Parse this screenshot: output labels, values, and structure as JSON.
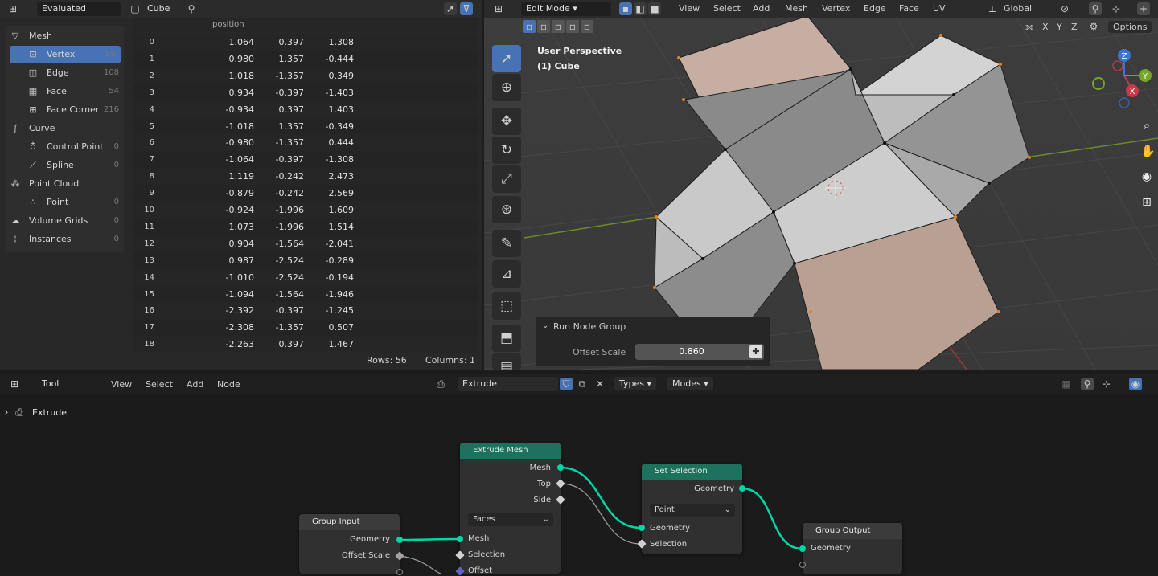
{
  "spreadsheet": {
    "header": {
      "mode": "Evaluated",
      "object": "Cube"
    },
    "column": "position",
    "tree": [
      {
        "label": "Mesh",
        "count": "",
        "level": 0,
        "icon": "mesh-icon",
        "glyph": "▽"
      },
      {
        "label": "Vertex",
        "count": "56",
        "level": 1,
        "icon": "vertex-icon",
        "glyph": "⊡",
        "selected": true
      },
      {
        "label": "Edge",
        "count": "108",
        "level": 1,
        "icon": "edge-icon",
        "glyph": "◫"
      },
      {
        "label": "Face",
        "count": "54",
        "level": 1,
        "icon": "face-icon",
        "glyph": "▦"
      },
      {
        "label": "Face Corner",
        "count": "216",
        "level": 1,
        "icon": "face-corner-icon",
        "glyph": "⊞"
      },
      {
        "label": "Curve",
        "count": "",
        "level": 0,
        "icon": "curve-icon",
        "glyph": "∫"
      },
      {
        "label": "Control Point",
        "count": "0",
        "level": 1,
        "icon": "control-point-icon",
        "glyph": "♁"
      },
      {
        "label": "Spline",
        "count": "0",
        "level": 1,
        "icon": "spline-icon",
        "glyph": "⟋"
      },
      {
        "label": "Point Cloud",
        "count": "",
        "level": 0,
        "icon": "point-cloud-icon",
        "glyph": "⁂"
      },
      {
        "label": "Point",
        "count": "0",
        "level": 1,
        "icon": "point-icon",
        "glyph": "∴"
      },
      {
        "label": "Volume Grids",
        "count": "0",
        "level": 0,
        "icon": "volume-grids-icon",
        "glyph": "☁"
      },
      {
        "label": "Instances",
        "count": "0",
        "level": 0,
        "icon": "instances-icon",
        "glyph": "⊹"
      }
    ],
    "rows": [
      [
        "0",
        "1.064",
        "0.397",
        "1.308"
      ],
      [
        "1",
        "0.980",
        "1.357",
        "-0.444"
      ],
      [
        "2",
        "1.018",
        "-1.357",
        "0.349"
      ],
      [
        "3",
        "0.934",
        "-0.397",
        "-1.403"
      ],
      [
        "4",
        "-0.934",
        "0.397",
        "1.403"
      ],
      [
        "5",
        "-1.018",
        "1.357",
        "-0.349"
      ],
      [
        "6",
        "-0.980",
        "-1.357",
        "0.444"
      ],
      [
        "7",
        "-1.064",
        "-0.397",
        "-1.308"
      ],
      [
        "8",
        "1.119",
        "-0.242",
        "2.473"
      ],
      [
        "9",
        "-0.879",
        "-0.242",
        "2.569"
      ],
      [
        "10",
        "-0.924",
        "-1.996",
        "1.609"
      ],
      [
        "11",
        "1.073",
        "-1.996",
        "1.514"
      ],
      [
        "12",
        "0.904",
        "-1.564",
        "-2.041"
      ],
      [
        "13",
        "0.987",
        "-2.524",
        "-0.289"
      ],
      [
        "14",
        "-1.010",
        "-2.524",
        "-0.194"
      ],
      [
        "15",
        "-1.094",
        "-1.564",
        "-1.946"
      ],
      [
        "16",
        "-2.392",
        "-0.397",
        "-1.245"
      ],
      [
        "17",
        "-2.308",
        "-1.357",
        "0.507"
      ],
      [
        "18",
        "-2.263",
        "0.397",
        "1.467"
      ]
    ],
    "footer": {
      "rows": "Rows: 56",
      "columns": "Columns: 1"
    }
  },
  "viewport": {
    "mode": "Edit Mode",
    "menus": [
      "View",
      "Select",
      "Add",
      "Mesh",
      "Vertex",
      "Edge",
      "Face",
      "UV"
    ],
    "orientation": "Global",
    "options": "Options",
    "axes": [
      "X",
      "Y",
      "Z"
    ],
    "gizmo": [
      "Z",
      "Y",
      "X"
    ],
    "perspective": "User Perspective",
    "object_label": "(1) Cube",
    "operator_panel": {
      "title": "Run Node Group",
      "field_label": "Offset Scale",
      "field_value": "0.860"
    }
  },
  "node_editor": {
    "mode": "Tool",
    "menus": [
      "View",
      "Select",
      "Add",
      "Node"
    ],
    "tree_name": "Extrude",
    "types": "Types",
    "modes": "Modes",
    "breadcrumb": "Extrude",
    "nodes": {
      "extrude": {
        "title": "Extrude Mesh",
        "out_mesh": "Mesh",
        "out_top": "Top",
        "out_side": "Side",
        "mode": "Faces",
        "in_mesh": "Mesh",
        "in_selection": "Selection",
        "in_offset": "Offset"
      },
      "set_selection": {
        "title": "Set Selection",
        "out_geometry": "Geometry",
        "domain": "Point",
        "in_geometry": "Geometry",
        "in_selection": "Selection"
      },
      "group_input": {
        "title": "Group Input",
        "out_geometry": "Geometry",
        "out_offset": "Offset Scale"
      },
      "group_output": {
        "title": "Group Output",
        "in_geometry": "Geometry"
      }
    }
  },
  "colors": {
    "geometry_socket": "#00d6a3",
    "float_socket": "#a1a1a1",
    "vector_socket": "#6363c7",
    "node_header_geo": "#1d725e",
    "selection_blue": "#4772b3"
  }
}
